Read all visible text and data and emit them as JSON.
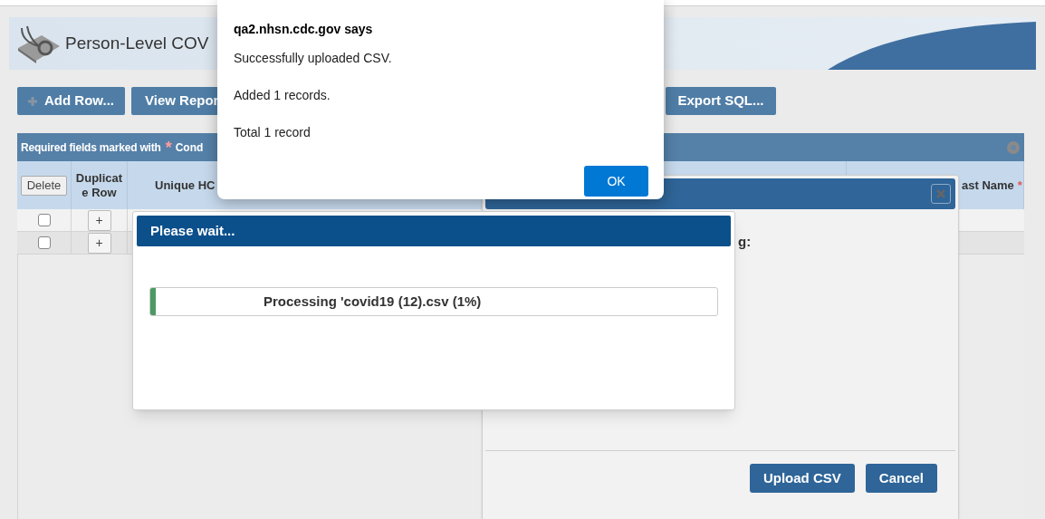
{
  "banner": {
    "title": "Person-Level COV"
  },
  "toolbar": {
    "buttons": [
      {
        "kind": "add",
        "label": "Add Row..."
      },
      {
        "kind": "plain",
        "label": "View Repor"
      },
      {
        "kind": "export",
        "label": "Export SQL..."
      }
    ]
  },
  "table": {
    "notice": "Required fields marked with",
    "notice_mark": "*",
    "notice_more": "Cond",
    "columns": [
      {
        "kind": "delete",
        "label": "Delete"
      },
      {
        "kind": "text",
        "lines": [
          "Duplicat",
          "e Row"
        ]
      },
      {
        "kind": "text",
        "lines": [
          "Unique HC"
        ]
      },
      {
        "kind": "blank"
      },
      {
        "kind": "required",
        "lines": [
          "ast Name"
        ],
        "mark": "*"
      }
    ],
    "rows": [
      {
        "checked": false,
        "duplicate": "+"
      },
      {
        "checked": false,
        "duplicate": "+"
      }
    ]
  },
  "upload_dialog": {
    "partial_text": "g:",
    "buttons": [
      "Upload CSV",
      "Cancel"
    ]
  },
  "progress_dialog": {
    "title": "Please wait...",
    "progress": {
      "level": 0.01,
      "text": "Processing 'covid19 (12).csv (1%)"
    }
  },
  "alert": {
    "title": "qa2.nhsn.cdc.gov says",
    "lines": [
      "Successfully uploaded CSV.",
      "Added 1 records.",
      "Total 1 record"
    ],
    "button": "OK"
  }
}
